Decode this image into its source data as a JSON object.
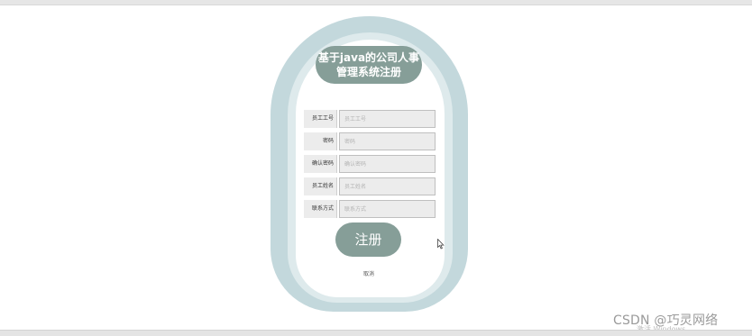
{
  "form": {
    "title_line1": "基于java的公司人事",
    "title_line2": "管理系统注册",
    "fields": [
      {
        "label": "员工工号",
        "placeholder": "员工工号"
      },
      {
        "label": "密码",
        "placeholder": "密码"
      },
      {
        "label": "确认密码",
        "placeholder": "确认密码"
      },
      {
        "label": "员工姓名",
        "placeholder": "员工姓名"
      },
      {
        "label": "联系方式",
        "placeholder": "联系方式"
      }
    ],
    "submit_label": "注册",
    "cancel_label": "取消"
  },
  "overlay": {
    "activate_windows": "激活 Windows",
    "watermark": "CSDN @巧灵网络"
  },
  "colors": {
    "arch_outer": "#c3d8dc",
    "arch_mid": "#deeaec",
    "accent": "#869e98",
    "field_bg": "#ececec"
  }
}
